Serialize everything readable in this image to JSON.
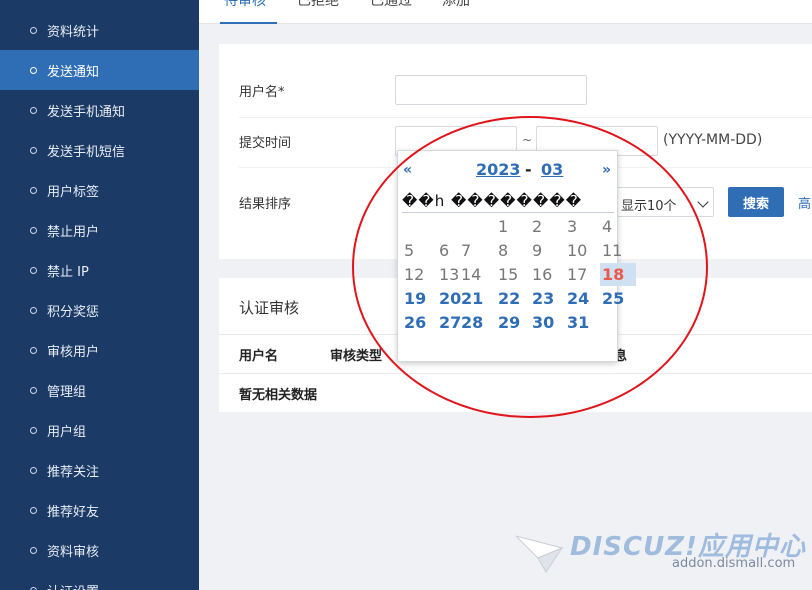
{
  "sidebar": {
    "items": [
      {
        "label": "资料统计",
        "active": false
      },
      {
        "label": "发送通知",
        "active": true
      },
      {
        "label": "发送手机通知",
        "active": false
      },
      {
        "label": "发送手机短信",
        "active": false
      },
      {
        "label": "用户标签",
        "active": false
      },
      {
        "label": "禁止用户",
        "active": false
      },
      {
        "label": "禁止 IP",
        "active": false
      },
      {
        "label": "积分奖惩",
        "active": false
      },
      {
        "label": "审核用户",
        "active": false
      },
      {
        "label": "管理组",
        "active": false
      },
      {
        "label": "用户组",
        "active": false
      },
      {
        "label": "推荐关注",
        "active": false
      },
      {
        "label": "推荐好友",
        "active": false
      },
      {
        "label": "资料审核",
        "active": false
      },
      {
        "label": "认证设置",
        "active": false
      }
    ]
  },
  "tabs": [
    {
      "label": "待审核",
      "active": true
    },
    {
      "label": "已拒绝",
      "active": false
    },
    {
      "label": "已通过",
      "active": false
    },
    {
      "label": "添加",
      "active": false
    }
  ],
  "form": {
    "username_label": "用户名*",
    "submit_time_label": "提交时间",
    "tilde": "~",
    "date_hint": "(YYYY-MM-DD)",
    "sort_label": "结果排序",
    "per_page_value": "显示10个",
    "search_label": "搜索",
    "advanced_label": "高"
  },
  "results": {
    "title": "认证审核",
    "columns": [
      "用户名",
      "审核类型",
      "息"
    ],
    "empty": "暂无相关数据"
  },
  "calendar": {
    "prev": "«",
    "next": "»",
    "year": "2023",
    "dash": "-",
    "month": "03",
    "weekday_row": "��h ��������",
    "weeks": [
      [
        "",
        "",
        "",
        "1",
        "2",
        "3",
        "4"
      ],
      [
        "5",
        "6",
        "7",
        "8",
        "9",
        "10",
        "11"
      ],
      [
        "12",
        "13",
        "14",
        "15",
        "16",
        "17",
        "18"
      ],
      [
        "19",
        "20",
        "21",
        "22",
        "23",
        "24",
        "25"
      ],
      [
        "26",
        "27",
        "28",
        "29",
        "30",
        "31",
        ""
      ]
    ],
    "today": "18"
  },
  "watermark": {
    "logo": "DISCUZ!应用中心",
    "url": "addon.dismall.com"
  },
  "colors": {
    "sidebar_bg": "#1b3a66",
    "sidebar_active": "#2f6db5",
    "accent": "#2f6db5",
    "today": "#e8594a",
    "annotation": "#e0141a"
  }
}
